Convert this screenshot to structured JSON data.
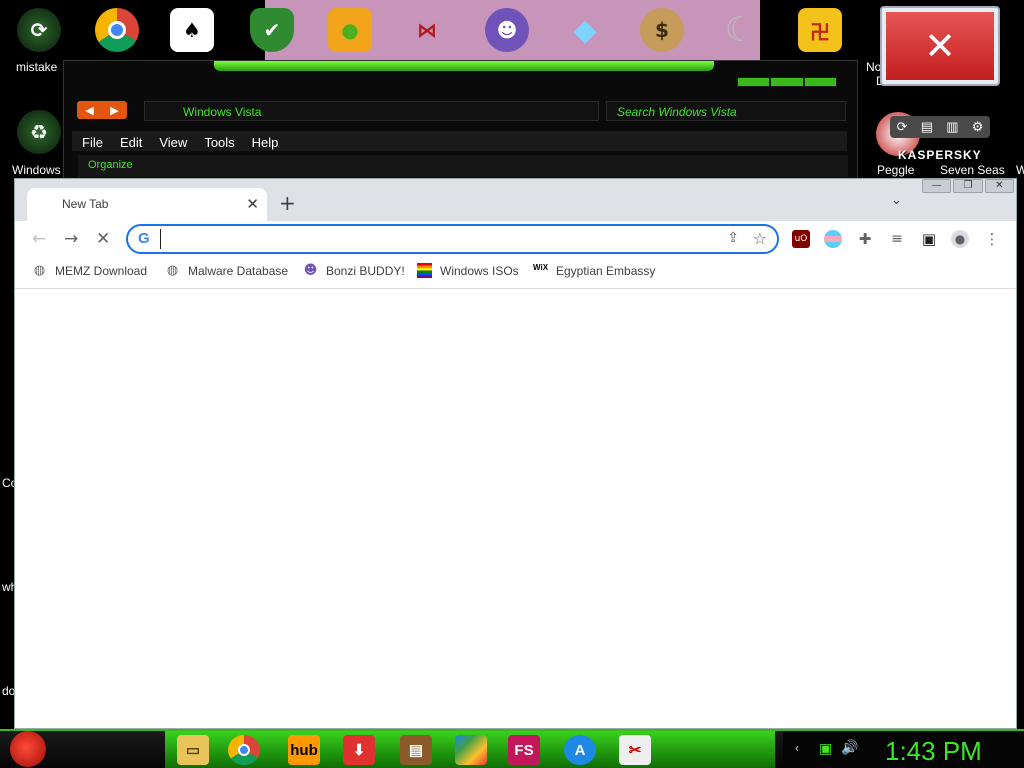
{
  "desktop": {
    "icons_top": [
      {
        "name": "mistake",
        "label": "mistake"
      },
      {
        "name": "chrome-icon"
      },
      {
        "name": "solitaire-icon"
      },
      {
        "name": "defender-icon"
      },
      {
        "name": "bad-piggies-icon"
      },
      {
        "name": "winged-icon"
      },
      {
        "name": "bonzi-icon"
      },
      {
        "name": "diamond-icon"
      },
      {
        "name": "money-bag-icon"
      },
      {
        "name": "moon-icon"
      },
      {
        "name": "mahjong-icon"
      }
    ],
    "labels": {
      "mistake": "mistake",
      "windows": "Windows",
      "peggle": "Peggle",
      "seven_seas": "Seven Seas",
      "no": "No",
      "d": "D",
      "w": "W",
      "co": "Co",
      "wh": "wh",
      "do": "do"
    },
    "kaspersky": "KASPERSKY"
  },
  "explorer": {
    "address": "Windows Vista",
    "search_placeholder": "Search Windows Vista",
    "menu": [
      "File",
      "Edit",
      "View",
      "Tools",
      "Help"
    ],
    "organize": "Organize"
  },
  "chrome": {
    "tab_title": "New Tab",
    "omnibox_value": "",
    "bookmarks": [
      {
        "label": "MEMZ Download",
        "icon": "globe-icon"
      },
      {
        "label": "Malware Database",
        "icon": "globe-icon"
      },
      {
        "label": "Bonzi BUDDY!",
        "icon": "bonzi-icon"
      },
      {
        "label": "Windows ISOs",
        "icon": "rainbow-flag-icon"
      },
      {
        "label": "Egyptian Embassy",
        "icon": "wix-icon"
      }
    ]
  },
  "taskbar": {
    "apps": [
      "file-explorer-icon",
      "chrome-icon",
      "hub-icon",
      "download-icon",
      "winrar-icon",
      "colorful-icon",
      "fs-icon",
      "avast-icon",
      "tool-icon"
    ],
    "hub_label": "hub",
    "fs_label": "FS",
    "clock": "1:43 PM"
  }
}
